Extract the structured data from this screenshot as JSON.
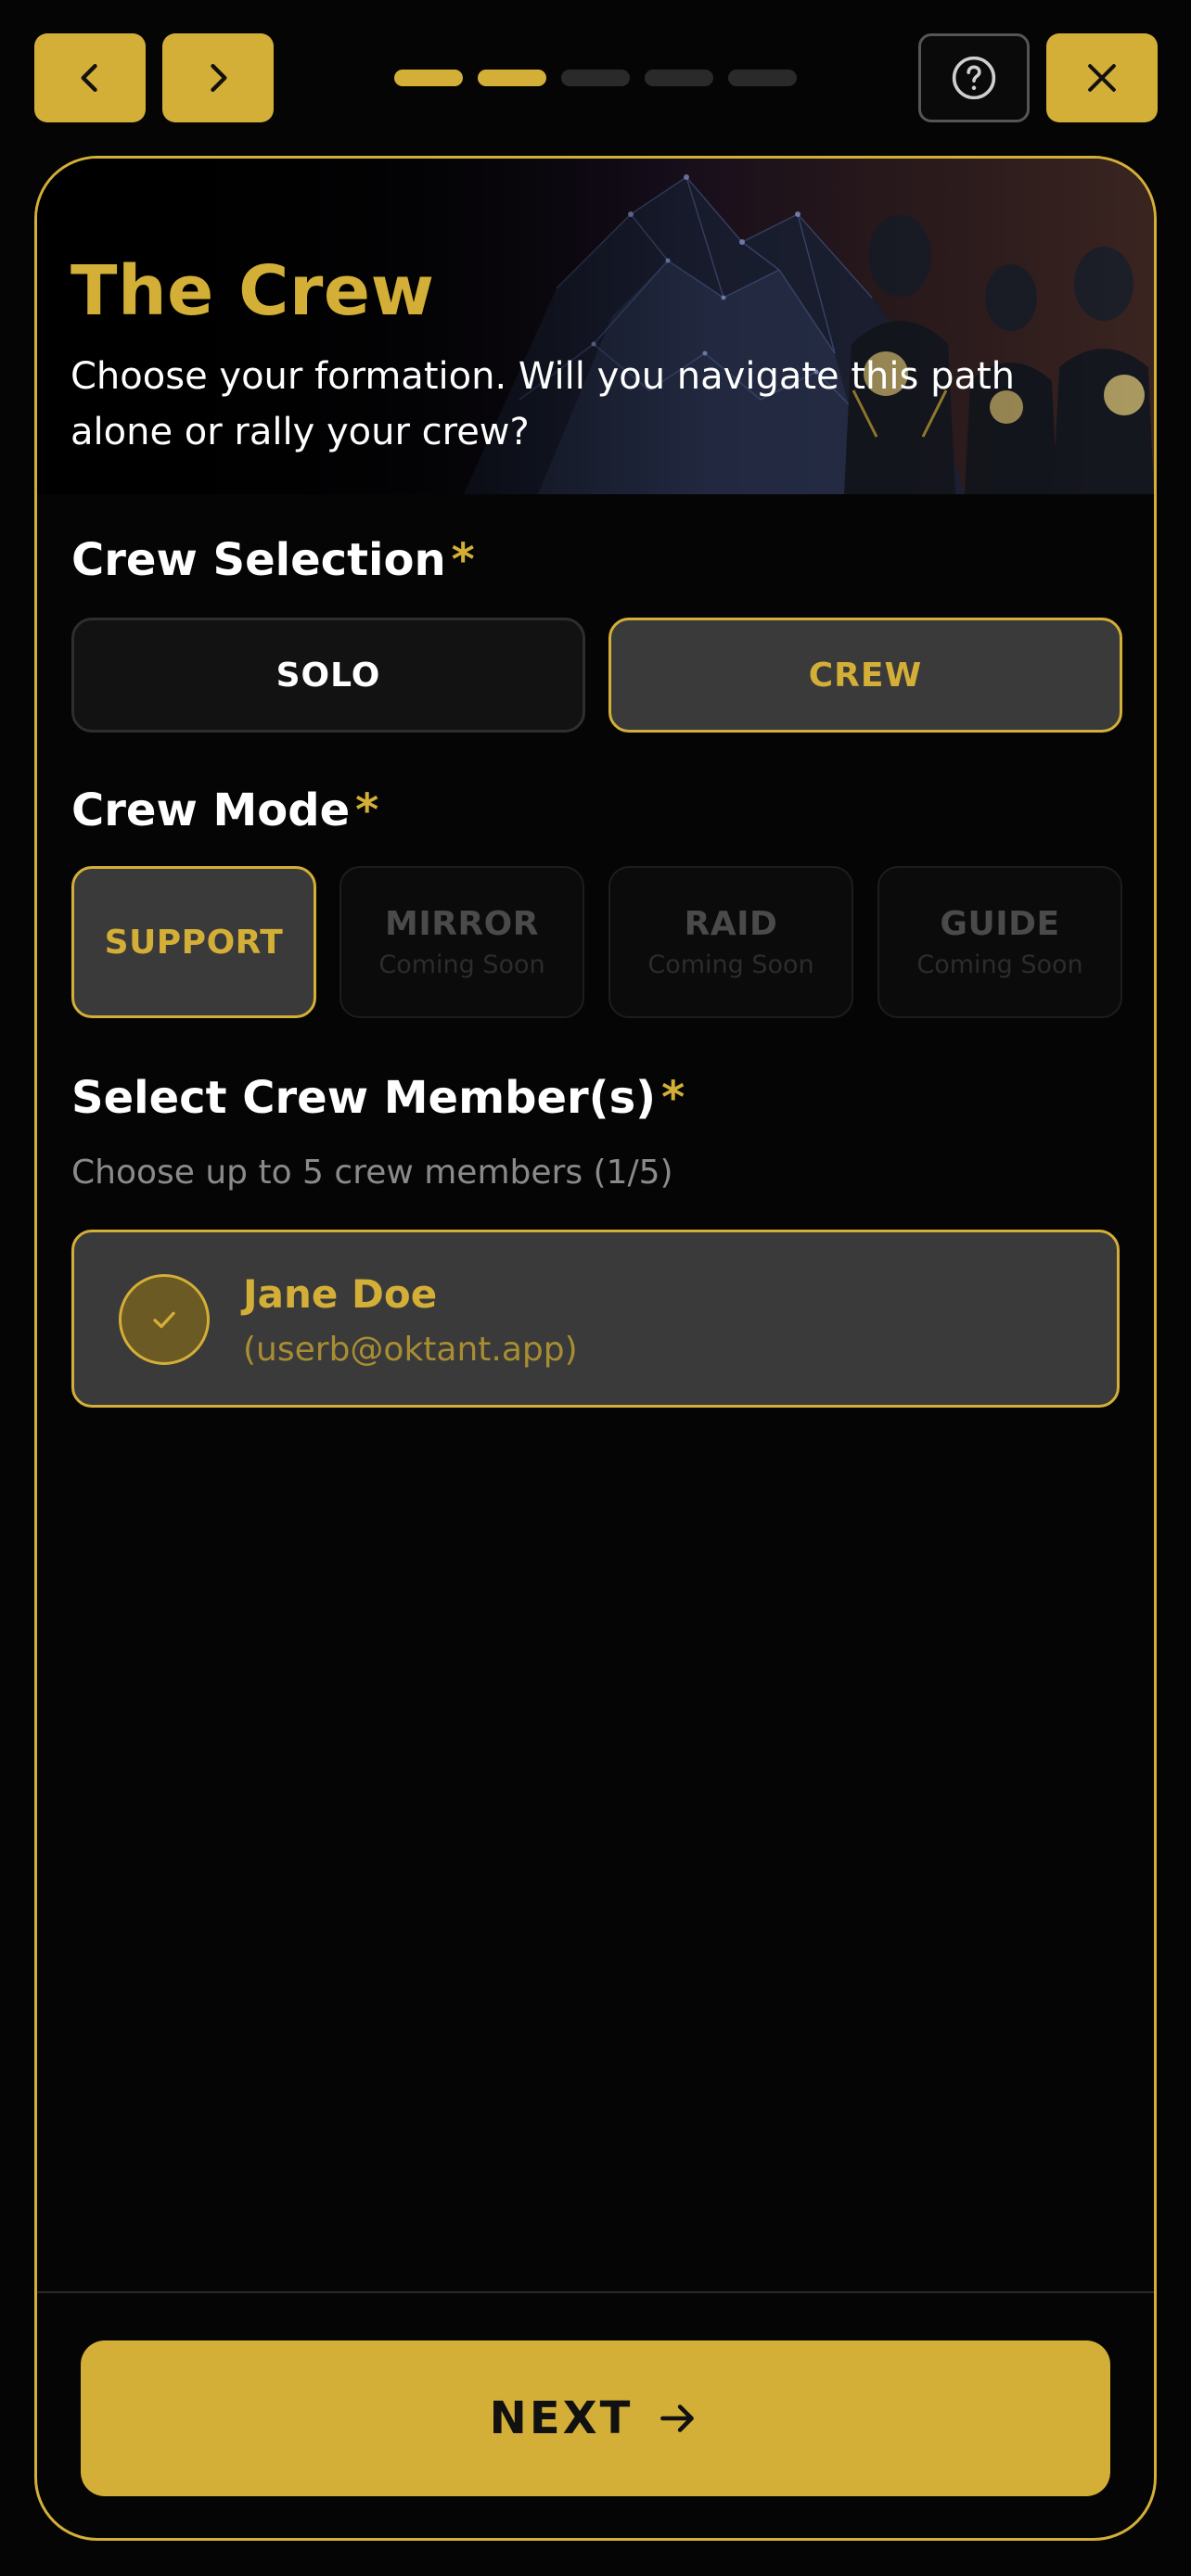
{
  "topbar": {
    "back_icon": "chevron-left-icon",
    "forward_icon": "chevron-right-icon",
    "help_icon": "help-circle-icon",
    "close_icon": "close-icon",
    "progress": {
      "total_steps": 5,
      "completed_steps": 2
    }
  },
  "hero": {
    "title": "The Crew",
    "subtitle": "Choose your formation. Will you navigate this path alone or rally your crew?"
  },
  "crew_selection": {
    "label": "Crew Selection",
    "required_mark": "*",
    "options": [
      {
        "label": "SOLO",
        "selected": false
      },
      {
        "label": "CREW",
        "selected": true
      }
    ]
  },
  "crew_mode": {
    "label": "Crew Mode",
    "required_mark": "*",
    "options": [
      {
        "label": "SUPPORT",
        "sublabel": "",
        "selected": true,
        "enabled": true
      },
      {
        "label": "MIRROR",
        "sublabel": "Coming Soon",
        "selected": false,
        "enabled": false
      },
      {
        "label": "RAID",
        "sublabel": "Coming Soon",
        "selected": false,
        "enabled": false
      },
      {
        "label": "GUIDE",
        "sublabel": "Coming Soon",
        "selected": false,
        "enabled": false
      }
    ]
  },
  "crew_members": {
    "label": "Select Crew Member(s)",
    "required_mark": "*",
    "hint": "Choose up to 5 crew members (1/5)",
    "members": [
      {
        "name": "Jane Doe",
        "email": "(userb@oktant.app)",
        "selected": true
      }
    ]
  },
  "footer": {
    "next_label": "NEXT",
    "next_icon": "arrow-right-icon"
  },
  "colors": {
    "accent": "#D4AF37",
    "background": "#050505",
    "selected_fill": "#3a3a3a"
  }
}
